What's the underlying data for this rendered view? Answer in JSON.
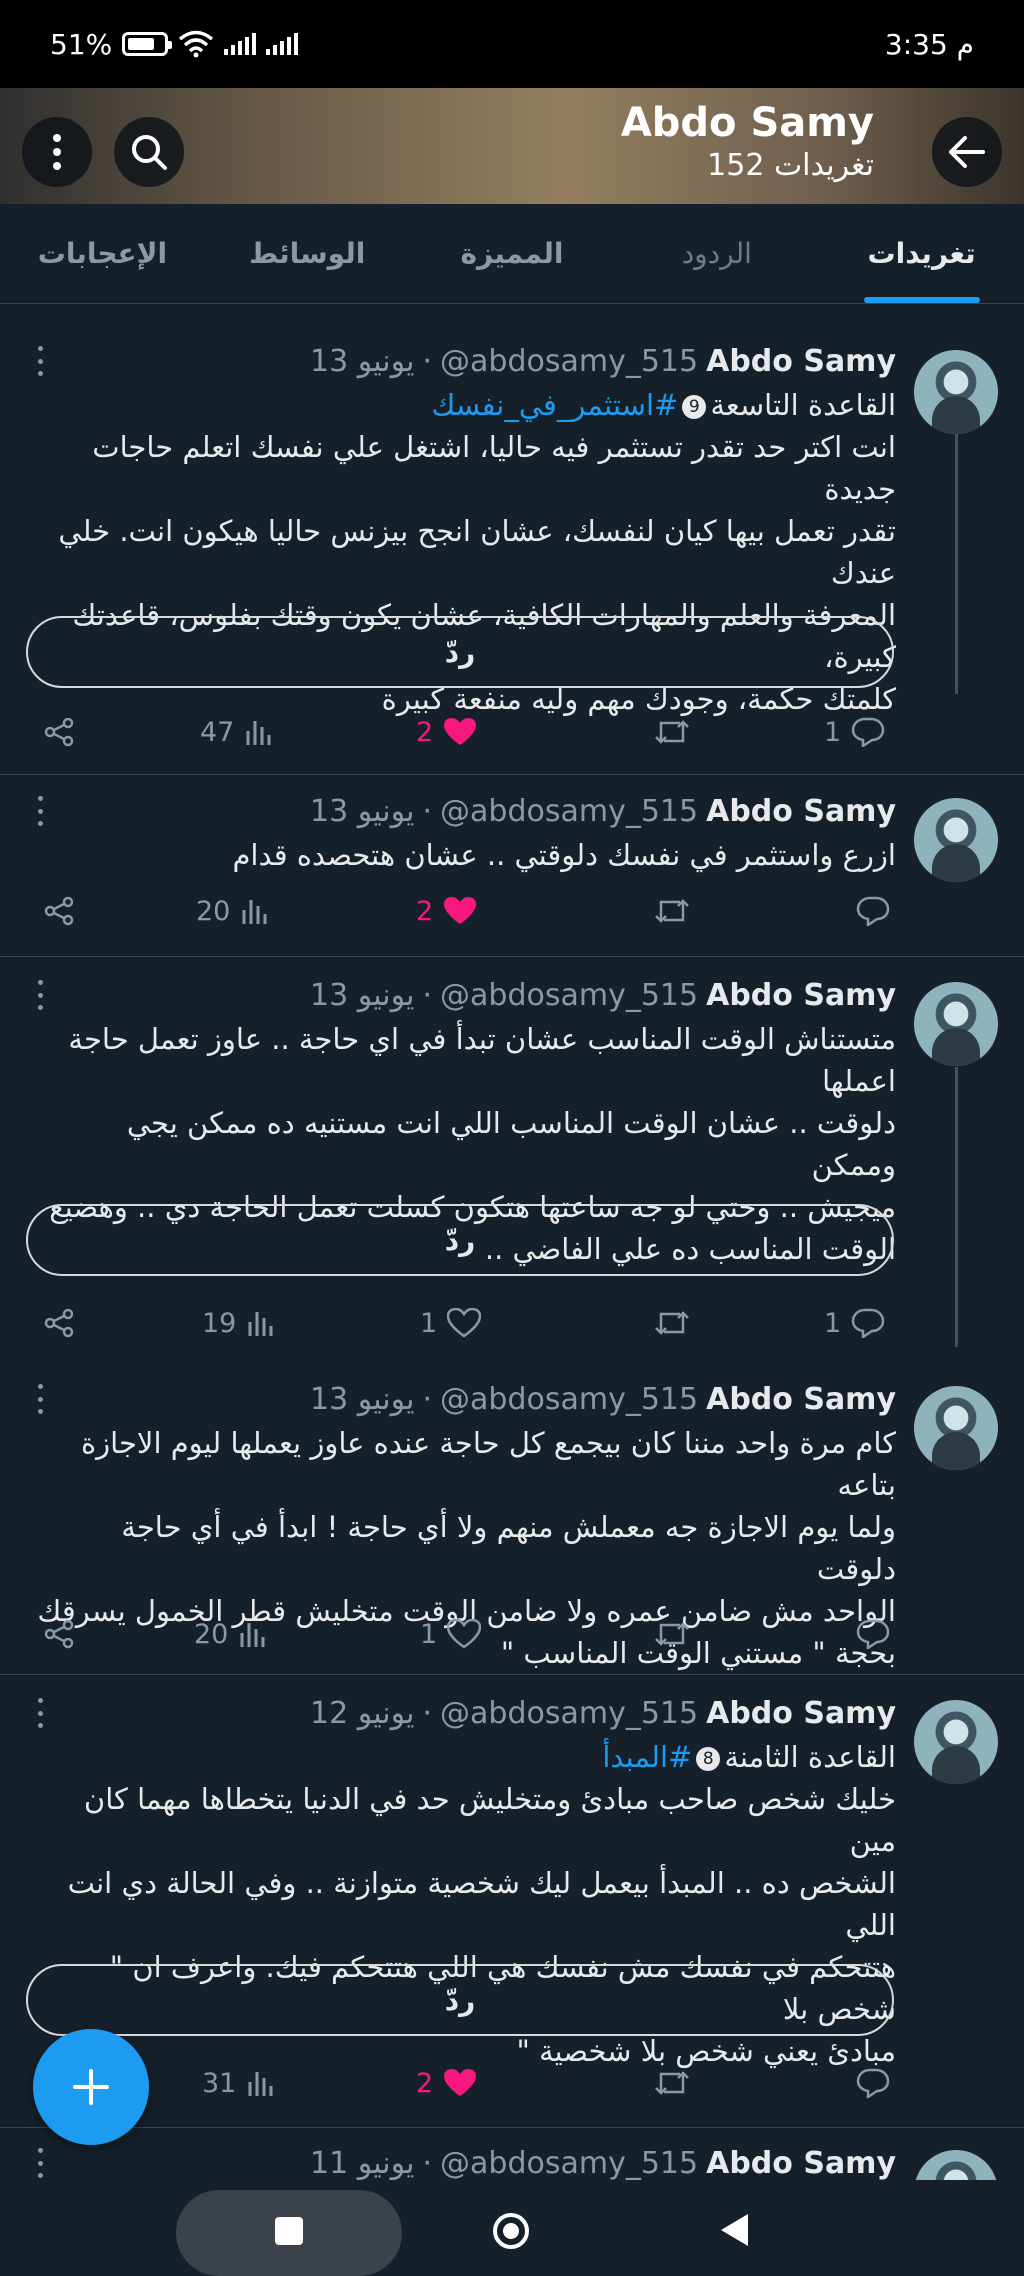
{
  "status_bar": {
    "time": "3:35 م",
    "battery": "51%"
  },
  "header": {
    "name": "Abdo Samy",
    "tweet_count": "152 تغريدات"
  },
  "tabs": [
    {
      "label": "تغريدات",
      "active": true
    },
    {
      "label": "الردود",
      "active": false
    },
    {
      "label": "المميزة",
      "active": false
    },
    {
      "label": "الوسائط",
      "active": false
    },
    {
      "label": "الإعجابات",
      "active": false
    }
  ],
  "reply_label": "ردّ",
  "tweets": [
    {
      "name": "Abdo Samy",
      "handle": "@abdosamy_515",
      "date": "13 يونيو",
      "heading": "القاعدة التاسعة",
      "heading_num": "9",
      "hashtag": "#استثمر_في_نفسك",
      "lines": [
        "انت اكتر حد تقدر تستثمر فيه حاليا، اشتغل علي نفسك اتعلم حاجات جديدة",
        "تقدر تعمل بيها كيان لنفسك، عشان انجح بيزنس حاليا هيكون انت. خلي عندك",
        "المعرفة والعلم والمهارات الكافية، عشان يكون وقتك بفلوس، قاعدتك كبيرة،",
        "كلمتك حكمة، وجودك مهم وليه منفعة كبيرة"
      ],
      "replies": "1",
      "retweets": "",
      "likes": "2",
      "views": "47"
    },
    {
      "name": "Abdo Samy",
      "handle": "@abdosamy_515",
      "date": "13 يونيو",
      "lines": [
        "ازرع واستثمر في نفسك دلوقتي .. عشان هتحصده قدام"
      ],
      "replies": "",
      "retweets": "",
      "likes": "2",
      "views": "20"
    },
    {
      "name": "Abdo Samy",
      "handle": "@abdosamy_515",
      "date": "13 يونيو",
      "lines": [
        "متستناش الوقت المناسب عشان تبدأ في اي حاجة .. عاوز تعمل حاجة اعملها",
        "دلوقت .. عشان الوقت المناسب اللي انت مستنيه ده ممكن يجي وممكن",
        "ميجيش .. وحتي لو جه ساعتها هتكون كسلت تعمل الحاجة دي .. وهضيع",
        "الوقت المناسب ده علي الفاضي .."
      ],
      "replies": "1",
      "retweets": "",
      "likes": "1",
      "views": "19"
    },
    {
      "name": "Abdo Samy",
      "handle": "@abdosamy_515",
      "date": "13 يونيو",
      "lines": [
        "كام مرة واحد مننا كان بيجمع كل حاجة عنده عاوز يعملها ليوم الاجازة بتاعه",
        "ولما يوم الاجازة جه معملش منهم ولا أي حاجة ! ابدأ في أي حاجة دلوقت",
        "الواحد مش ضامن عمره ولا ضامن الوقت متخليش قطر الخمول يسرقك",
        "بحجة \" مستني الوقت المناسب \""
      ],
      "replies": "",
      "retweets": "",
      "likes": "1",
      "views": "20"
    },
    {
      "name": "Abdo Samy",
      "handle": "@abdosamy_515",
      "date": "12 يونيو",
      "heading": "القاعدة الثامنة",
      "heading_num": "8",
      "hashtag": "#المبدأ",
      "lines": [
        "خليك شخص صاحب مبادئ ومتخليش حد في الدنيا يتخطاها مهما كان مين",
        "الشخص ده .. المبدأ بيعمل ليك شخصية متوازنة .. وفي الحالة دي انت اللي",
        "هتتحكم في نفسك مش نفسك هي اللي هتتحكم فيك. واعرف ان \" شخص بلا",
        "مبادئ يعني شخص بلا شخصية \""
      ],
      "replies": "",
      "retweets": "",
      "likes": "2",
      "views": "31"
    },
    {
      "name": "Abdo Samy",
      "handle": "@abdosamy_515",
      "date": "11 يونيو"
    }
  ],
  "icons": {
    "back": "arrow-left-icon",
    "search": "search-icon",
    "more": "more-vertical-icon",
    "reply": "comment-icon",
    "retweet": "retweet-icon",
    "like": "heart-icon",
    "views": "bar-chart-icon",
    "share": "share-icon",
    "compose": "plus-icon"
  },
  "colors": {
    "accent": "#1d9bf0",
    "like": "#f91880",
    "background": "#15202b"
  }
}
